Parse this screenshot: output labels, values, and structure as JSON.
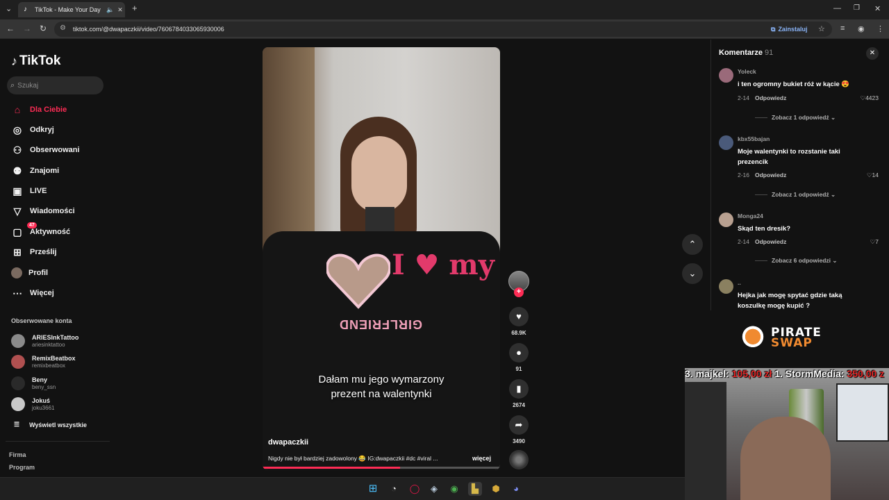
{
  "browser": {
    "tab_title": "TikTok - Make Your Day",
    "url": "tiktok.com/@dwapaczkii/video/7606784033065930006",
    "install_label": "Zainstaluj"
  },
  "sidebar": {
    "logo": "TikTok",
    "search_placeholder": "Szukaj",
    "items": [
      {
        "label": "Dla Ciebie",
        "icon": "home-icon"
      },
      {
        "label": "Odkryj",
        "icon": "compass-icon"
      },
      {
        "label": "Obserwowani",
        "icon": "following-icon"
      },
      {
        "label": "Znajomi",
        "icon": "friends-icon"
      },
      {
        "label": "LIVE",
        "icon": "live-icon"
      },
      {
        "label": "Wiadomości",
        "icon": "messages-icon"
      },
      {
        "label": "Aktywność",
        "icon": "activity-icon",
        "badge": "47"
      },
      {
        "label": "Prześlij",
        "icon": "upload-icon"
      },
      {
        "label": "Profil",
        "icon": "profile-icon"
      },
      {
        "label": "Więcej",
        "icon": "more-icon"
      }
    ],
    "following_title": "Obserwowane konta",
    "accounts": [
      {
        "name": "ARIESInkTattoo",
        "handle": "ariesinktattoo"
      },
      {
        "name": "RemixBeatbox",
        "handle": "remixbeatbox"
      },
      {
        "name": "Beny",
        "handle": "beny_ssn"
      },
      {
        "name": "Jokuś",
        "handle": "joku3661"
      }
    ],
    "show_all": "Wyświetl wszystkie",
    "footer": [
      "Firma",
      "Program"
    ]
  },
  "video": {
    "caption_line1": "Dałam mu jego wymarzony",
    "caption_line2": "prezent na walentynki",
    "author": "dwapaczkii",
    "description": "Nigdy nie był bardziej zadowolony 😂 IG:dwapaczkii #dc #viral ...",
    "more": "więcej",
    "shirt_text_top": "I ♥ my",
    "shirt_text_bottom": "GIRLFRIEND",
    "progress": 0.58
  },
  "actions": {
    "likes": "68.9K",
    "comments": "91",
    "saves": "2674",
    "shares": "3490"
  },
  "comments": {
    "title": "Komentarze",
    "count": "91",
    "items": [
      {
        "user": "Yoleck",
        "text": "i ten ogromny bukiet róż w kącie 😍",
        "date": "2-14",
        "reply": "Odpowiedz",
        "likes": "4423",
        "more": "Zobacz 1 odpowiedź"
      },
      {
        "user": "kbx55bajan",
        "text": "Moje walentynki to rozstanie taki prezencik",
        "date": "2-16",
        "reply": "Odpowiedz",
        "likes": "14",
        "more": "Zobacz 1 odpowiedź"
      },
      {
        "user": "Monga24",
        "text": "Skąd ten dresik?",
        "date": "2-14",
        "reply": "Odpowiedz",
        "likes": "7",
        "more": "Zobacz 6 odpowiedzi"
      },
      {
        "user": "..",
        "text": "Hejka jak mogę spytać gdzie taką koszulkę mogę kupić ?"
      }
    ]
  },
  "overlay": {
    "brand_top": "PIRATE",
    "brand_bottom": "SWAP",
    "donation1_name": "3. majkel:",
    "donation1_amount": "105,00 zł",
    "donation2_name": "1. StormMedia:",
    "donation2_amount": "350,00 z"
  },
  "colors": {
    "accent": "#fe2c55",
    "link": "#8ab4f8"
  }
}
